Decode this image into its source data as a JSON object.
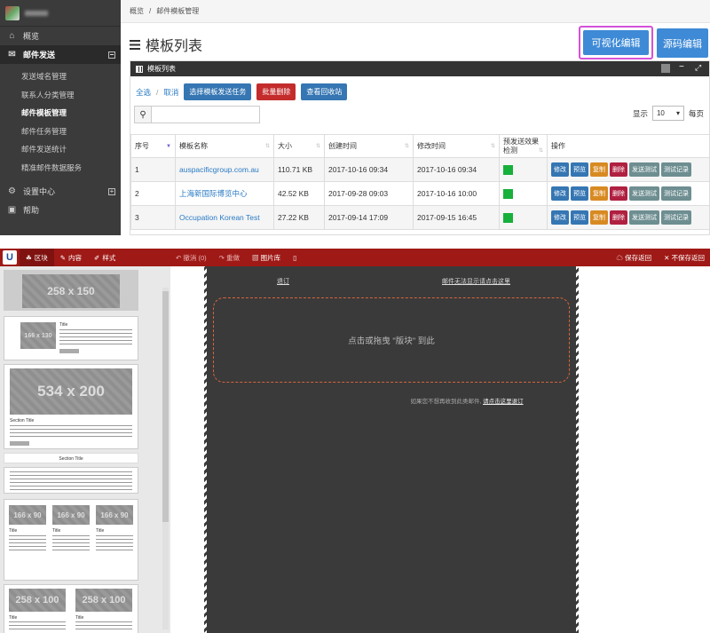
{
  "sidebar": {
    "user_name": "",
    "items": [
      {
        "label": "概览",
        "icon": "home-icon"
      },
      {
        "label": "邮件发送",
        "icon": "envelope-icon",
        "toggle": "−"
      }
    ],
    "sub_items": [
      "发送域名管理",
      "联系人分类管理",
      "邮件模板管理",
      "邮件任务管理",
      "邮件发送统计",
      "精准邮件数据服务"
    ],
    "bottom_items": [
      {
        "label": "设置中心",
        "icon": "gear-icon",
        "toggle": "+"
      },
      {
        "label": "帮助",
        "icon": "help-icon"
      }
    ]
  },
  "breadcrumb": {
    "root": "概览",
    "sep": "/",
    "current": "邮件模板管理"
  },
  "page_title": "模板列表",
  "buttons": {
    "visual_edit": "可视化编辑",
    "source_edit": "源码编辑"
  },
  "panel": {
    "title": "模板列表",
    "select_all": "全选",
    "sep": "/",
    "cancel": "取消",
    "actions": {
      "choose_task": "选择模板发送任务",
      "batch_delete": "批量删除",
      "recycle": "查看回收站"
    },
    "page_size_label": "显示",
    "page_size": "10",
    "per_page": "每页"
  },
  "table": {
    "headers": [
      "序号",
      "模板名称",
      "大小",
      "创建时间",
      "修改时间",
      "预发送效果检测",
      "操作"
    ],
    "rows": [
      {
        "no": "1",
        "name": "auspacificgroup.com.au",
        "size": "110.71 KB",
        "created": "2017-10-16 09:34",
        "modified": "2017-10-16 09:34"
      },
      {
        "no": "2",
        "name": "上海新国际博览中心",
        "size": "42.52 KB",
        "created": "2017-09-28 09:03",
        "modified": "2017-10-16 10:00"
      },
      {
        "no": "3",
        "name": "Occupation Korean Test",
        "size": "27.22 KB",
        "created": "2017-09-14 17:09",
        "modified": "2017-09-15 16:45"
      }
    ],
    "ops": [
      "修改",
      "预览",
      "复制",
      "删除",
      "发送测试",
      "测试记录"
    ]
  },
  "editor": {
    "logo": "U",
    "tabs": [
      "区块",
      "内容",
      "样式"
    ],
    "undo": "撤消 (0)",
    "redo": "重做",
    "image_lib": "图片库",
    "preview": "▯",
    "save_back": "保存返回",
    "no_save_back": "不保存返回",
    "blocks": [
      "258 x 150",
      "166 x 130",
      "534 x 200",
      "Section Title",
      "Section Title",
      "166 x 90",
      "166 x 90",
      "166 x 90",
      "258 x 100",
      "258 x 100"
    ],
    "block_title": "Title",
    "canvas": {
      "unsubscribe": "退订",
      "view_online": "邮件无法显示请点击这里",
      "drop_hint": "点击或拖曳 \"版块\" 到此",
      "footer_text": "如果您不想再收到此类邮件,",
      "footer_link": "请点击这里退订"
    }
  },
  "colors": {
    "accent": "#3e8ad6",
    "editor_bar": "#9f1916",
    "highlight": "#d452d8",
    "status_ok": "#17b03b"
  }
}
